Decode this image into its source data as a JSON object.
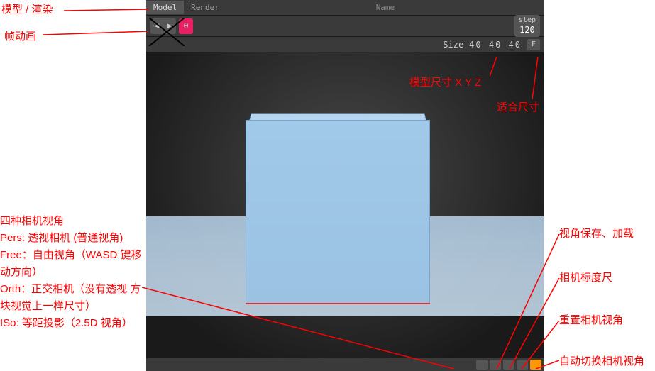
{
  "tabs": {
    "model": "Model",
    "render": "Render",
    "name": "Name"
  },
  "frame": {
    "current": "0",
    "step_label": "step",
    "step_value": "120"
  },
  "size": {
    "label": "Size",
    "x": "40",
    "y": "40",
    "z": "40",
    "fit": "F"
  },
  "annotations": {
    "model_render": "模型 / 渲染",
    "frame_anim": "帧动画",
    "size_xyz": "模型尺寸 X Y  Z",
    "fit_size": "适合尺寸",
    "camera_heading": "四种相机视角",
    "camera_pers": "Pers: 透视相机 (普通视角)",
    "camera_free": "Free：自由视角（WASD 键移动方向）",
    "camera_orth": "Orth：正交相机（没有透视 方块视觉上一样尺寸）",
    "camera_iso": "ISo: 等距投影（2.5D 视角）",
    "view_save_load": "视角保存、加载",
    "camera_scale": "相机标度尺",
    "reset_camera": "重置相机视角",
    "auto_switch": "自动切换相机视角"
  }
}
